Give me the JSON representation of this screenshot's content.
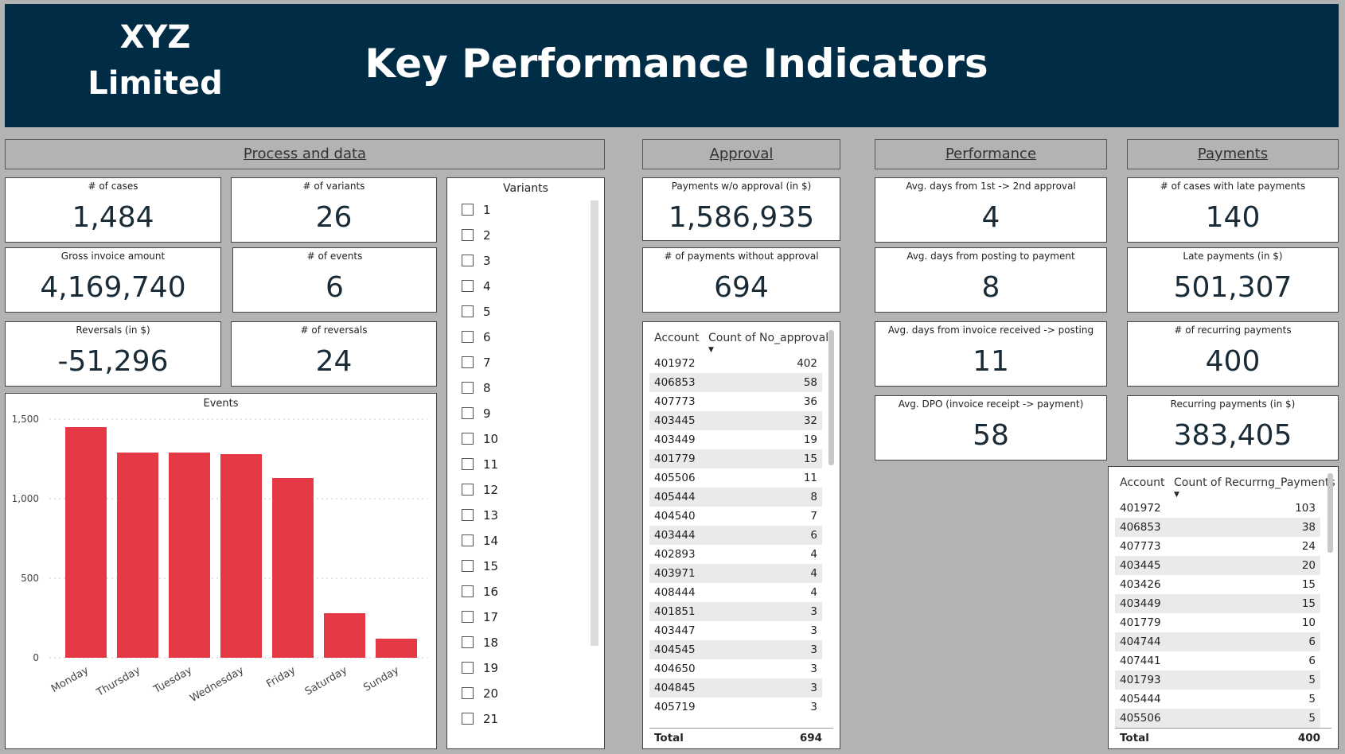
{
  "header": {
    "company_line1": "XYZ",
    "company_line2": "Limited",
    "title": "Key Performance Indicators",
    "background": "#002c45"
  },
  "sections": {
    "process": "Process and data",
    "approval": "Approval",
    "performance": "Performance",
    "payments": "Payments"
  },
  "kpis": {
    "cases": {
      "label": "# of cases",
      "value": "1,484"
    },
    "variants": {
      "label": "# of variants",
      "value": "26"
    },
    "gross": {
      "label": "Gross invoice amount",
      "value": "4,169,740"
    },
    "events": {
      "label": "# of events",
      "value": "6"
    },
    "reversals_amt": {
      "label": "Reversals (in $)",
      "value": "-51,296"
    },
    "reversals_cnt": {
      "label": "# of reversals",
      "value": "24"
    },
    "pay_wo_approval": {
      "label": "Payments w/o approval (in $)",
      "value": "1,586,935"
    },
    "num_wo_approval": {
      "label": "# of payments without approval",
      "value": "694"
    },
    "avg_1st_2nd": {
      "label": "Avg. days from 1st -> 2nd approval",
      "value": "4"
    },
    "avg_post_pay": {
      "label": "Avg. days from posting to payment",
      "value": "8"
    },
    "avg_inv_post": {
      "label": "Avg. days from invoice received -> posting",
      "value": "11"
    },
    "avg_dpo": {
      "label": "Avg. DPO (invoice receipt -> payment)",
      "value": "58"
    },
    "late_cases": {
      "label": "# of cases with late payments",
      "value": "140"
    },
    "late_amt": {
      "label": "Late payments (in $)",
      "value": "501,307"
    },
    "recurring_cnt": {
      "label": "# of recurring payments",
      "value": "400"
    },
    "recurring_amt": {
      "label": "Recurring payments (in $)",
      "value": "383,405"
    }
  },
  "variants_slicer": {
    "title": "Variants",
    "items": [
      "1",
      "2",
      "3",
      "4",
      "5",
      "6",
      "7",
      "8",
      "9",
      "10",
      "11",
      "12",
      "13",
      "14",
      "15",
      "16",
      "17",
      "18",
      "19",
      "20",
      "21"
    ]
  },
  "approval_table": {
    "col1": "Account",
    "col2": "Count of No_approval",
    "rows": [
      [
        "401972",
        "402"
      ],
      [
        "406853",
        "58"
      ],
      [
        "407773",
        "36"
      ],
      [
        "403445",
        "32"
      ],
      [
        "403449",
        "19"
      ],
      [
        "401779",
        "15"
      ],
      [
        "405506",
        "11"
      ],
      [
        "405444",
        "8"
      ],
      [
        "404540",
        "7"
      ],
      [
        "403444",
        "6"
      ],
      [
        "402893",
        "4"
      ],
      [
        "403971",
        "4"
      ],
      [
        "408444",
        "4"
      ],
      [
        "401851",
        "3"
      ],
      [
        "403447",
        "3"
      ],
      [
        "404545",
        "3"
      ],
      [
        "404650",
        "3"
      ],
      [
        "404845",
        "3"
      ],
      [
        "405719",
        "3"
      ]
    ],
    "total_label": "Total",
    "total_value": "694"
  },
  "recurring_table": {
    "col1": "Account",
    "col2": "Count of Recurrng_Payments",
    "rows": [
      [
        "401972",
        "103"
      ],
      [
        "406853",
        "38"
      ],
      [
        "407773",
        "24"
      ],
      [
        "403445",
        "20"
      ],
      [
        "403426",
        "15"
      ],
      [
        "403449",
        "15"
      ],
      [
        "401779",
        "10"
      ],
      [
        "404744",
        "6"
      ],
      [
        "407441",
        "6"
      ],
      [
        "401793",
        "5"
      ],
      [
        "405444",
        "5"
      ],
      [
        "405506",
        "5"
      ]
    ],
    "total_label": "Total",
    "total_value": "400"
  },
  "chart_data": {
    "type": "bar",
    "title": "Events",
    "categories": [
      "Monday",
      "Thursday",
      "Tuesday",
      "Wednesday",
      "Friday",
      "Saturday",
      "Sunday"
    ],
    "values": [
      1450,
      1290,
      1290,
      1280,
      1130,
      280,
      120
    ],
    "ylim": [
      0,
      1500
    ],
    "yticks": [
      0,
      500,
      1000,
      1500
    ],
    "ytick_labels": [
      "0",
      "500",
      "1,000",
      "1,500"
    ],
    "grid": true,
    "color": "#e63946"
  }
}
